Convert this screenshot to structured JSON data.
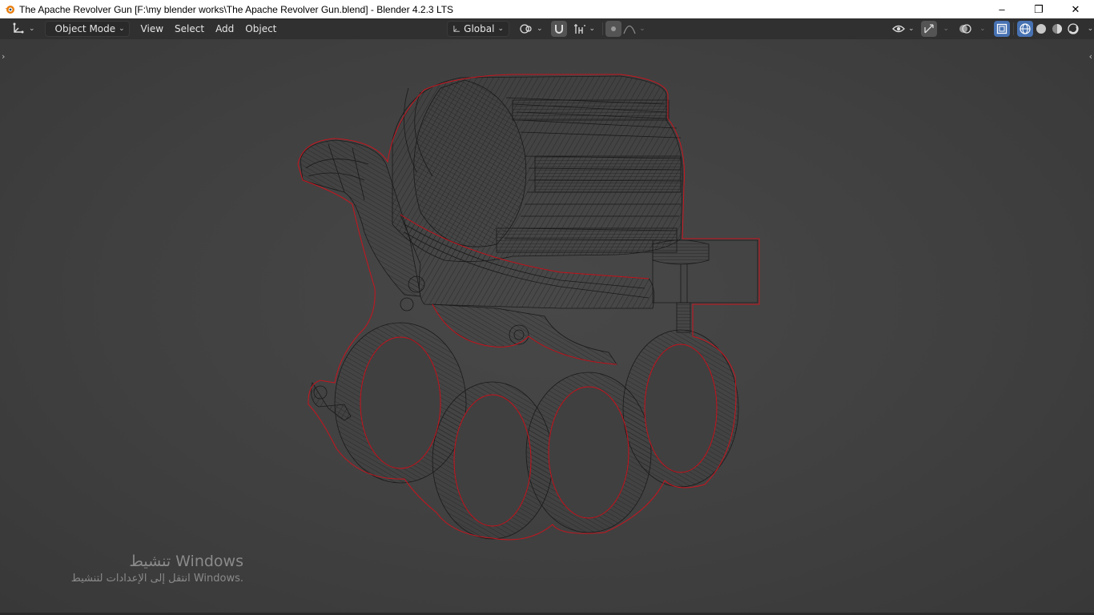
{
  "window": {
    "title": "The Apache Revolver Gun [F:\\my blender works\\The Apache Revolver Gun.blend] - Blender 4.2.3 LTS",
    "minimize": "–",
    "restore": "❐",
    "close": "✕"
  },
  "header": {
    "editor_type_icon": "axis-gizmo-icon",
    "mode_label": "Object Mode",
    "menus": [
      "View",
      "Select",
      "Add",
      "Object"
    ],
    "orientation_label": "Global",
    "pivot_icon": "pivot-icon",
    "snap_icon": "magnet-icon",
    "proportional_icon": "proportional-edit-icon",
    "visibility_icon": "eye-icon",
    "gizmo_icon": "gizmo-icon",
    "overlay_icon": "overlay-icon",
    "xray_icon": "xray-icon",
    "shading_modes": [
      "wireframe",
      "solid",
      "material",
      "rendered"
    ],
    "active_shading": "wireframe"
  },
  "viewport": {
    "object_name": "Apache Revolver Gun",
    "outline_color": "#c8141e",
    "wire_color": "#151515",
    "watermark_line1": "تنشيط Windows",
    "watermark_line2": "انتقل إلى الإعدادات لتنشيط Windows."
  }
}
